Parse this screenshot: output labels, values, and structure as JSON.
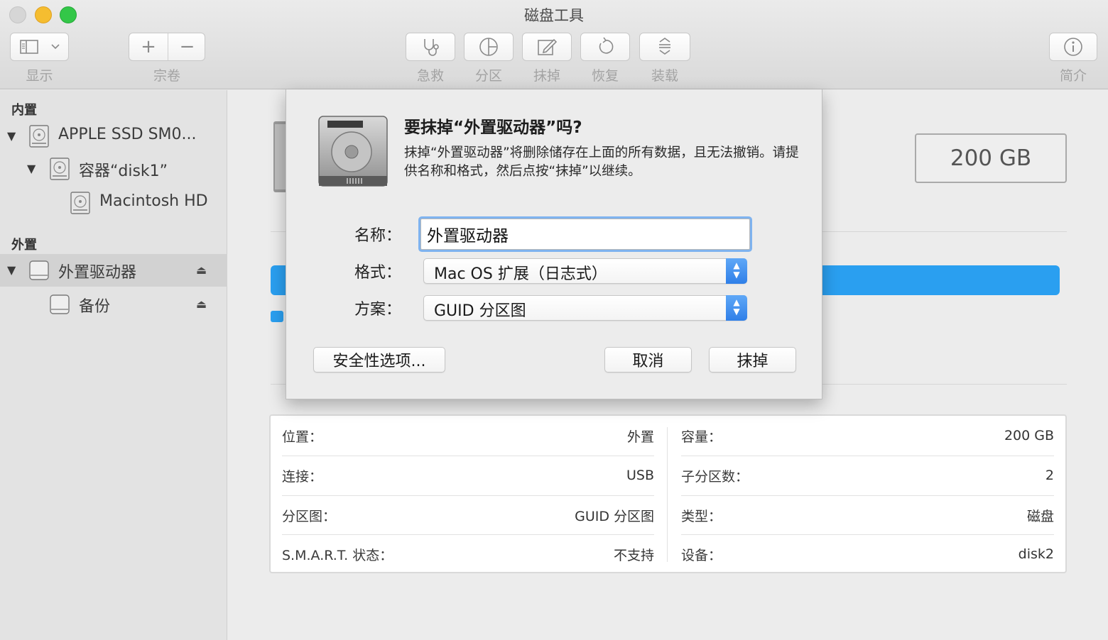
{
  "window": {
    "title": "磁盘工具"
  },
  "toolbar": {
    "view_label": "显示",
    "volume_label": "宗卷",
    "first_aid_label": "急救",
    "partition_label": "分区",
    "erase_label": "抹掉",
    "restore_label": "恢复",
    "mount_label": "装载",
    "info_label": "简介",
    "add_symbol": "+",
    "remove_symbol": "−"
  },
  "sidebar": {
    "internal_header": "内置",
    "external_header": "外置",
    "items": [
      {
        "label": "APPLE SSD SM0...",
        "icon": "internal-disk-icon",
        "level": 0
      },
      {
        "label": "容器“disk1”",
        "icon": "container-icon",
        "level": 1
      },
      {
        "label": "Macintosh HD",
        "icon": "volume-icon",
        "level": 2
      },
      {
        "label": "外置驱动器",
        "icon": "external-disk-icon",
        "level": 0,
        "selected": true
      },
      {
        "label": "备份",
        "icon": "external-volume-icon",
        "level": 1
      }
    ]
  },
  "main": {
    "capacity": "200 GB",
    "usage_color": "#2a9ff0",
    "info": {
      "left": [
        {
          "key": "位置：",
          "value": "外置"
        },
        {
          "key": "连接：",
          "value": "USB"
        },
        {
          "key": "分区图：",
          "value": "GUID 分区图"
        },
        {
          "key": "S.M.A.R.T. 状态：",
          "value": "不支持"
        }
      ],
      "right": [
        {
          "key": "容量：",
          "value": "200 GB"
        },
        {
          "key": "子分区数：",
          "value": "2"
        },
        {
          "key": "类型：",
          "value": "磁盘"
        },
        {
          "key": "设备：",
          "value": "disk2"
        }
      ]
    }
  },
  "dialog": {
    "title": "要抹掉“外置驱动器”吗?",
    "description": "抹掉“外置驱动器”将删除储存在上面的所有数据，且无法撤销。请提供名称和格式，然后点按“抹掉”以继续。",
    "name_label": "名称：",
    "name_value": "外置驱动器",
    "format_label": "格式：",
    "format_value": "Mac OS 扩展（日志式）",
    "scheme_label": "方案：",
    "scheme_value": "GUID 分区图",
    "security_button": "安全性选项...",
    "cancel_button": "取消",
    "erase_button": "抹掉"
  }
}
